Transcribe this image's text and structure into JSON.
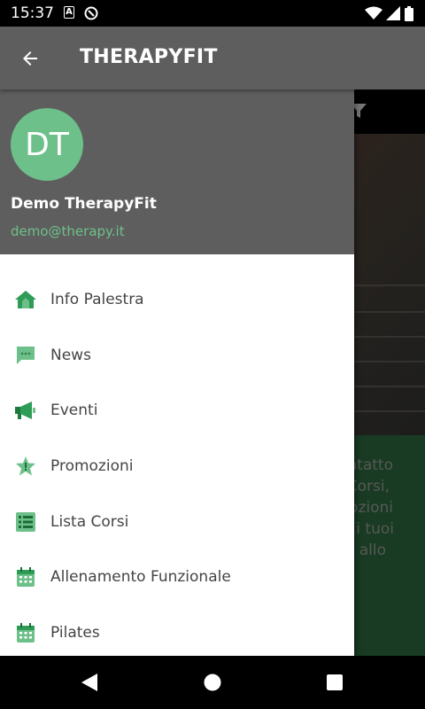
{
  "status_bar": {
    "time": "15:37",
    "a_badge": "A"
  },
  "app_bar": {
    "title": "THERAPYFIT"
  },
  "drawer": {
    "avatar_initials": "DT",
    "user_name": "Demo TherapyFit",
    "user_email": "demo@therapy.it",
    "menu": [
      {
        "label": "Info Palestra",
        "icon": "home-icon"
      },
      {
        "label": "News",
        "icon": "chat-bubble-icon"
      },
      {
        "label": "Eventi",
        "icon": "megaphone-icon"
      },
      {
        "label": "Promozioni",
        "icon": "star-badge-icon"
      },
      {
        "label": "Lista Corsi",
        "icon": "list-icon"
      },
      {
        "label": "Allenamento Funzionale",
        "icon": "calendar-icon"
      },
      {
        "label": "Pilates",
        "icon": "calendar-icon"
      }
    ]
  },
  "background_text": [
    "ntatto",
    "Corsi,",
    "ozioni",
    "i tuoi",
    "o allo"
  ],
  "colors": {
    "accent": "#6ec08a",
    "icon_green": "#2e9b57",
    "bar": "#5e5e5e",
    "dark_green": "#2f6a40"
  }
}
